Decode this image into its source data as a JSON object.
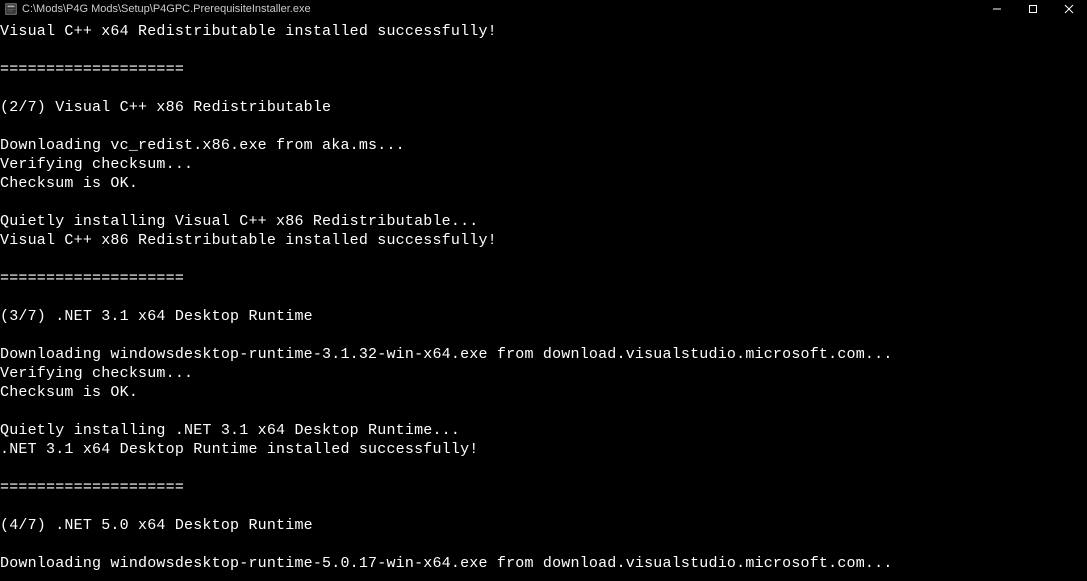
{
  "titlebar": {
    "path": "C:\\Mods\\P4G Mods\\Setup\\P4GPC.PrerequisiteInstaller.exe"
  },
  "console": {
    "lines": [
      "Visual C++ x64 Redistributable installed successfully!",
      "",
      "====================",
      "",
      "(2/7) Visual C++ x86 Redistributable",
      "",
      "Downloading vc_redist.x86.exe from aka.ms...",
      "Verifying checksum...",
      "Checksum is OK.",
      "",
      "Quietly installing Visual C++ x86 Redistributable...",
      "Visual C++ x86 Redistributable installed successfully!",
      "",
      "====================",
      "",
      "(3/7) .NET 3.1 x64 Desktop Runtime",
      "",
      "Downloading windowsdesktop-runtime-3.1.32-win-x64.exe from download.visualstudio.microsoft.com...",
      "Verifying checksum...",
      "Checksum is OK.",
      "",
      "Quietly installing .NET 3.1 x64 Desktop Runtime...",
      ".NET 3.1 x64 Desktop Runtime installed successfully!",
      "",
      "====================",
      "",
      "(4/7) .NET 5.0 x64 Desktop Runtime",
      "",
      "Downloading windowsdesktop-runtime-5.0.17-win-x64.exe from download.visualstudio.microsoft.com..."
    ]
  }
}
